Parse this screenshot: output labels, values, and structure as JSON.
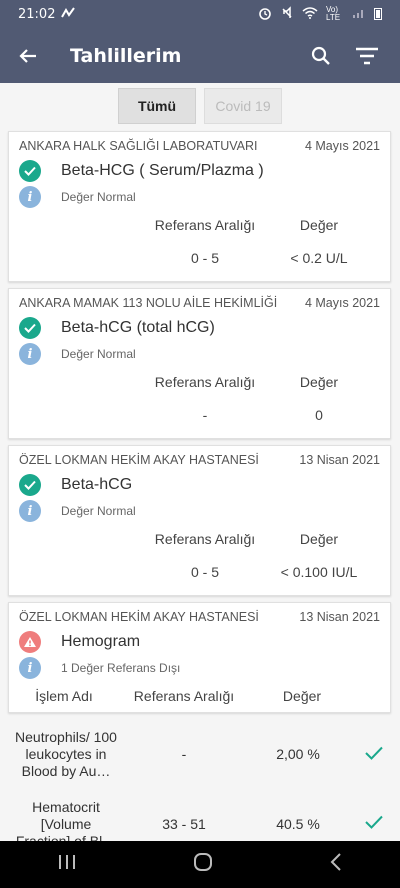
{
  "status": {
    "time": "21:02",
    "net": "Vo) LTE"
  },
  "app": {
    "title": "Tahlillerim"
  },
  "tabs": [
    {
      "label": "Tümü",
      "active": true
    },
    {
      "label": "Covid 19",
      "active": false
    }
  ],
  "results": [
    {
      "lab": "ANKARA HALK SAĞLIĞI LABORATUVARI",
      "date": "4 Mayıs 2021",
      "test": "Beta-HCG ( Serum/Plazma )",
      "note": "Değer Normal",
      "ref_header": "Referans Aralığı",
      "val_header": "Değer",
      "range": "0 - 5",
      "value": "< 0.2 U/L"
    },
    {
      "lab": "ANKARA MAMAK 113 NOLU AİLE HEKİMLİĞİ",
      "date": "4 Mayıs 2021",
      "test": "Beta-hCG (total hCG)",
      "note": "Değer Normal",
      "ref_header": "Referans Aralığı",
      "val_header": "Değer",
      "range": "-",
      "value": "0"
    },
    {
      "lab": "ÖZEL LOKMAN HEKİM AKAY HASTANESİ",
      "date": "13 Nisan 2021",
      "test": "Beta-hCG",
      "note": "Değer Normal",
      "ref_header": "Referans Aralığı",
      "val_header": "Değer",
      "range": "0 - 5",
      "value": "< 0.100 IU/L"
    }
  ],
  "hemogram": {
    "lab": "ÖZEL LOKMAN HEKİM AKAY HASTANESİ",
    "date": "13 Nisan 2021",
    "test": "Hemogram",
    "note": "1 Değer Referans Dışı",
    "headers": {
      "name": "İşlem Adı",
      "ref": "Referans Aralığı",
      "val": "Değer"
    },
    "rows": [
      {
        "name": "Neutrophils/ 100 leukocytes in Blood by Au…",
        "range": "-",
        "value": "2,00 %"
      },
      {
        "name": "Hematocrit [Volume Fraction] of Bl…",
        "range": "33 - 51",
        "value": "40.5 %"
      }
    ]
  }
}
